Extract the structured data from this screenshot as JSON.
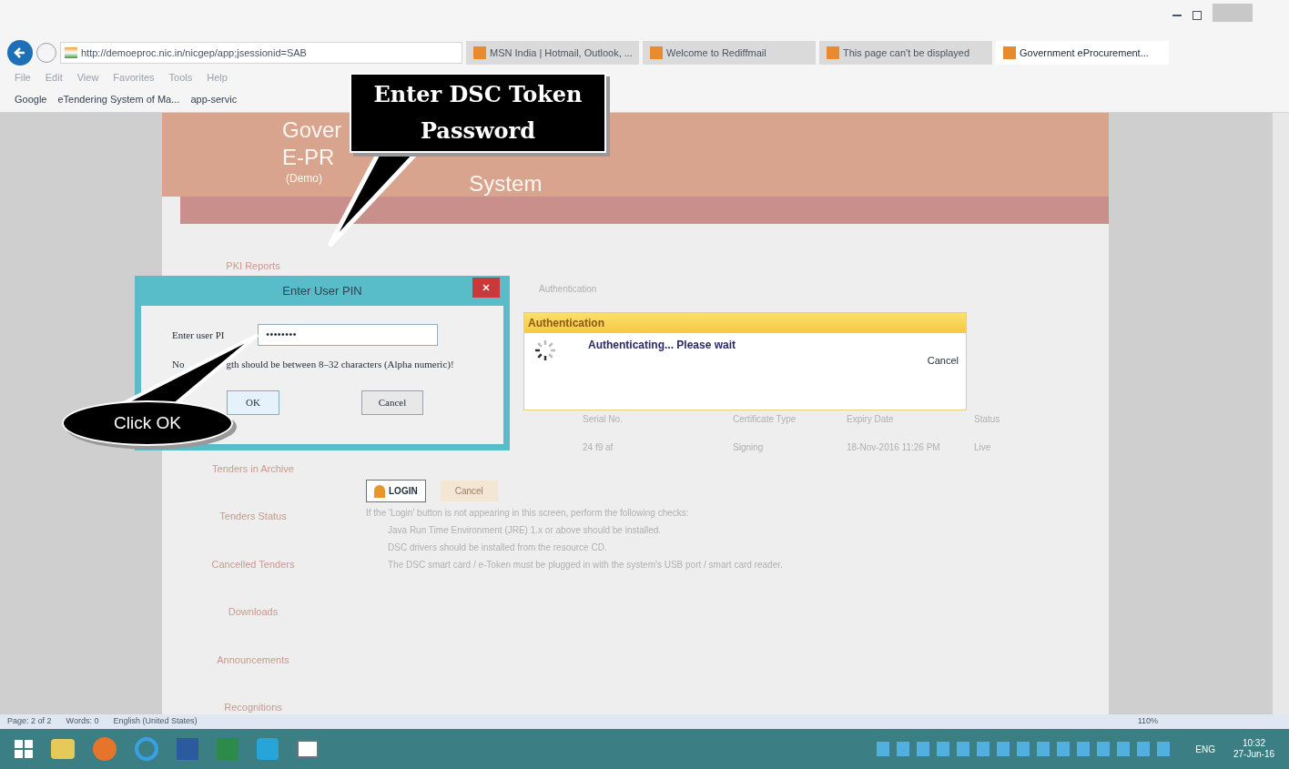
{
  "browser": {
    "address": "http://demoeproc.nic.in/nicgep/app;jsessionid=SAB",
    "tabs": [
      {
        "title": "MSN India | Hotmail, Outlook, ...",
        "selected": false
      },
      {
        "title": "Welcome to Rediffmail",
        "selected": false
      },
      {
        "title": "This page can't be displayed",
        "selected": false
      },
      {
        "title": "Government eProcurement...",
        "selected": true
      }
    ],
    "menu": [
      "File",
      "Edit",
      "View",
      "Favorites",
      "Tools",
      "Help"
    ],
    "favorites": [
      "Google",
      "eTendering System of Ma...",
      "app-servic"
    ]
  },
  "site": {
    "banner": [
      "Gover",
      "E-PR",
      "(Demo)",
      "System"
    ],
    "sidebar": [
      "PKI Reports",
      "Tenders in Archive",
      "Tenders Status",
      "Cancelled Tenders",
      "Downloads",
      "Announcements",
      "Recognitions"
    ],
    "section_title": "Authentication",
    "table": {
      "columns": [
        "Serial No.",
        "Certificate Type",
        "Expiry Date",
        "Status"
      ],
      "rows": [
        [
          "24 f9 af",
          "Signing",
          "18-Nov-2016 11:26 PM",
          "Live"
        ]
      ]
    },
    "login_button": "LOGIN",
    "cancel_button": "Cancel",
    "instructions": "If the 'Login' button is not appearing in this screen, perform the following checks:",
    "checks": [
      "Java Run Time Environment (JRE) 1.x or above should be installed.",
      "DSC drivers should be installed from the resource CD.",
      "The DSC smart card / e-Token must be plugged in with the system's USB port / smart card reader."
    ]
  },
  "pin_dialog": {
    "title": "Enter User PIN",
    "label": "Enter user PI",
    "value": "••••••••",
    "note": [
      "No",
      "gth should be between 8–32 characters (Alpha numeric)!"
    ],
    "ok": "OK",
    "cancel": "Cancel"
  },
  "auth_dialog": {
    "title": "Authentication",
    "message": "Authenticating... Please wait",
    "cancel": "Cancel"
  },
  "callouts": [
    {
      "kind": "box",
      "text": "Enter DSC Token Password"
    },
    {
      "kind": "ellipse",
      "text": "Click OK"
    }
  ],
  "status_bar": [
    "Page: 2 of 2",
    "Words: 0",
    "English (United States)"
  ],
  "zoom": "110%",
  "tray": {
    "lang": "ENG",
    "time": "10:32",
    "date": "27-Jun-16"
  }
}
